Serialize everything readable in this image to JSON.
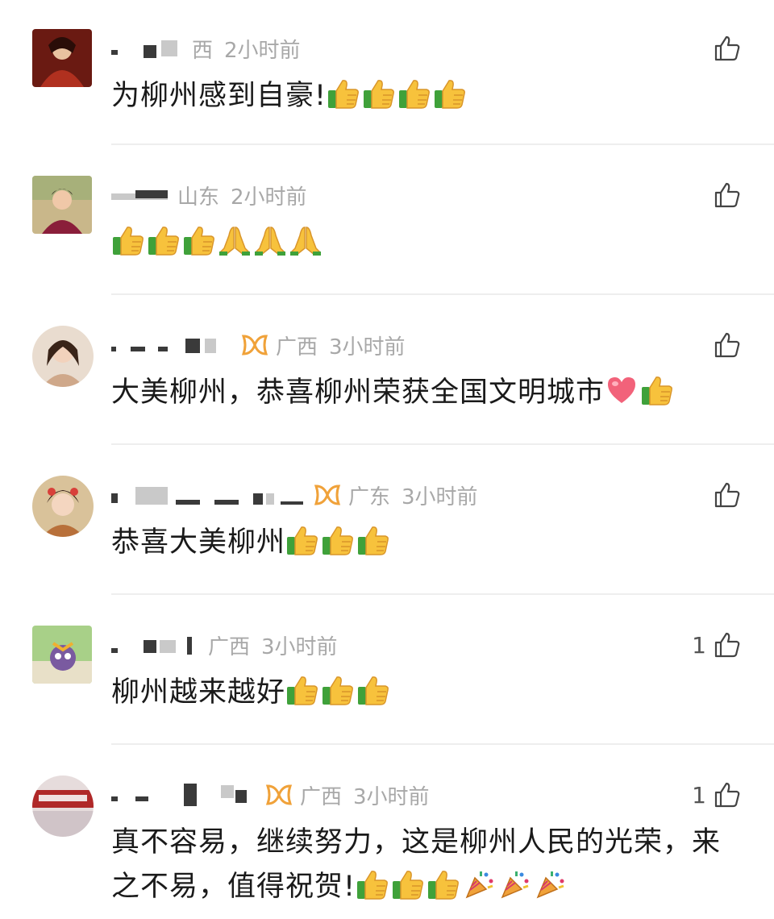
{
  "comments": [
    {
      "region": "西",
      "time": "2小时前",
      "text": "为柳州感到自豪!",
      "likes": "",
      "avatar_color": "#8a2a1e",
      "emojis": [
        "thumbs-up",
        "thumbs-up",
        "thumbs-up",
        "thumbs-up"
      ]
    },
    {
      "region": "山东",
      "time": "2小时前",
      "text": "",
      "likes": "",
      "avatar_color": "#b9a37a",
      "emojis": [
        "thumbs-up",
        "thumbs-up",
        "thumbs-up",
        "pray",
        "pray",
        "pray"
      ]
    },
    {
      "region": "广西",
      "time": "3小时前",
      "text": "大美柳州，恭喜柳州荣获全国文明城市",
      "likes": "",
      "avatar_color": "#e7c9b4",
      "emojis": [
        "heart",
        "thumbs-up"
      ]
    },
    {
      "region": "广东",
      "time": "3小时前",
      "text": "恭喜大美柳州",
      "likes": "",
      "avatar_color": "#c96a4a",
      "emojis": [
        "thumbs-up",
        "thumbs-up",
        "thumbs-up"
      ]
    },
    {
      "region": "广西",
      "time": "3小时前",
      "text": "柳州越来越好",
      "likes": "1",
      "avatar_color": "#7aa25a",
      "emojis": [
        "thumbs-up",
        "thumbs-up",
        "thumbs-up"
      ]
    },
    {
      "region": "广西",
      "time": "3小时前",
      "text": "真不容易，继续努力，这是柳州人民的光荣，来之不易，值得祝贺!",
      "likes": "1",
      "avatar_color": "#c8b8b8",
      "emojis": [
        "thumbs-up",
        "thumbs-up",
        "thumbs-up",
        "party-popper",
        "party-popper",
        "party-popper"
      ]
    }
  ],
  "colors": {
    "meta": "#a8a8a8",
    "text": "#1a1a1a",
    "divider": "#eeeeee",
    "badge": "#f0a23a"
  }
}
